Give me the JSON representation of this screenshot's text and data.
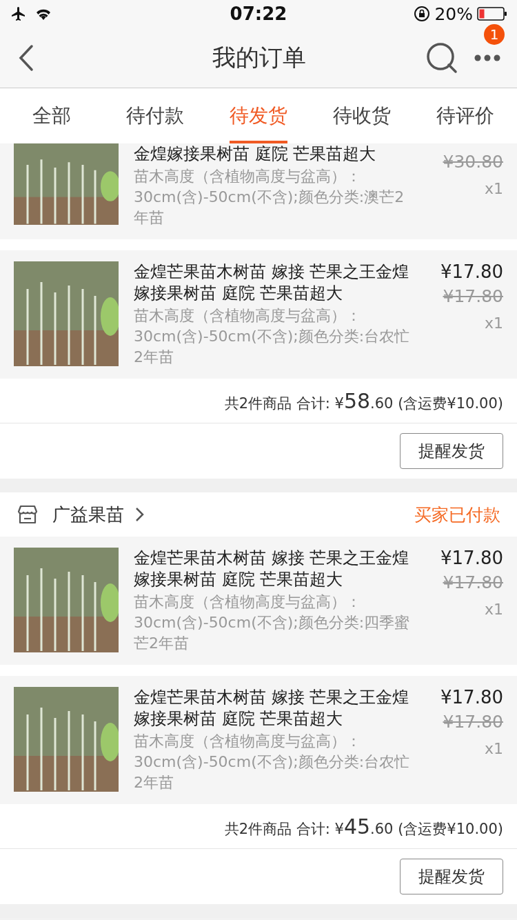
{
  "status_bar": {
    "time": "07:22",
    "battery_text": "20%"
  },
  "nav": {
    "title": "我的订单",
    "badge": "1"
  },
  "tabs": [
    {
      "label": "全部",
      "selected": false
    },
    {
      "label": "待付款",
      "selected": false
    },
    {
      "label": "待发货",
      "selected": true
    },
    {
      "label": "待收货",
      "selected": false
    },
    {
      "label": "待评价",
      "selected": false
    }
  ],
  "orders": [
    {
      "items": [
        {
          "title": "金煌嫁接果树苗 庭院 芒果苗超大",
          "description": "苗木高度（含植物高度与盆高）：30cm(含)-50cm(不含);颜色分类:澳芒2年苗",
          "original_price": "¥30.80",
          "quantity": "x1"
        },
        {
          "title": "金煌芒果苗木树苗 嫁接 芒果之王金煌嫁接果树苗 庭院 芒果苗超大",
          "description": "苗木高度（含植物高度与盆高）：30cm(含)-50cm(不含);颜色分类:台农忙2年苗",
          "price": "¥17.80",
          "original_price": "¥17.80",
          "quantity": "x1"
        }
      ],
      "summary": {
        "label": "共2件商品 合计:",
        "currency": "¥",
        "amount_int": "58",
        "amount_dec": ".60",
        "shipping": "(含运费¥10.00)"
      },
      "button": "提醒发货"
    },
    {
      "shop": {
        "name": "广益果苗",
        "status": "买家已付款"
      },
      "items": [
        {
          "title": "金煌芒果苗木树苗 嫁接 芒果之王金煌嫁接果树苗 庭院 芒果苗超大",
          "description": "苗木高度（含植物高度与盆高）：30cm(含)-50cm(不含);颜色分类:四季蜜芒2年苗",
          "price": "¥17.80",
          "original_price": "¥17.80",
          "quantity": "x1"
        },
        {
          "title": "金煌芒果苗木树苗 嫁接 芒果之王金煌嫁接果树苗 庭院 芒果苗超大",
          "description": "苗木高度（含植物高度与盆高）：30cm(含)-50cm(不含);颜色分类:台农忙2年苗",
          "price": "¥17.80",
          "original_price": "¥17.80",
          "quantity": "x1"
        }
      ],
      "summary": {
        "label": "共2件商品 合计:",
        "currency": "¥",
        "amount_int": "45",
        "amount_dec": ".60",
        "shipping": "(含运费¥10.00)"
      },
      "button": "提醒发货"
    }
  ]
}
